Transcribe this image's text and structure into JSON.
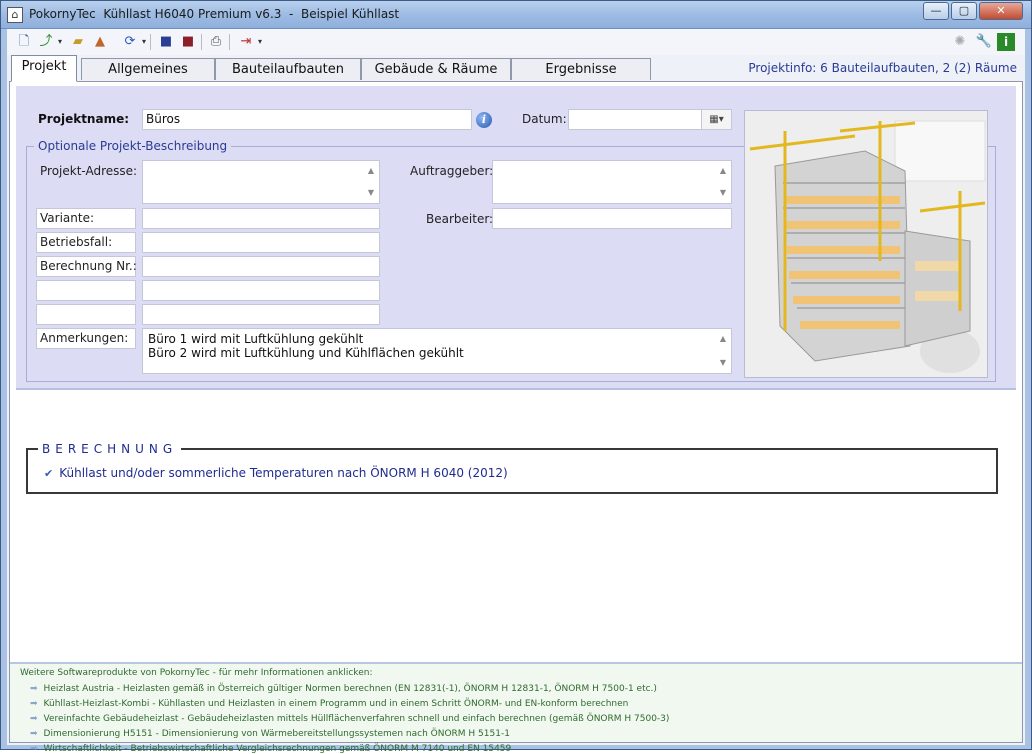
{
  "window": {
    "title": "PokornyTec  Kühllast H6040 Premium v6.3  -  Beispiel Kühllast",
    "minimize": "—",
    "maximize": "▢",
    "close": "✕"
  },
  "toolbar": {
    "icons": [
      "new-file-icon",
      "save-as-icon",
      "open-folder-icon",
      "import-icon",
      "refresh-icon",
      "save-icon",
      "save-all-icon",
      "print-icon",
      "exit-icon",
      "cycle-icon",
      "wrench-icon",
      "info-icon"
    ]
  },
  "tabs": [
    {
      "label": "Projekt",
      "active": true
    },
    {
      "label": "Allgemeines"
    },
    {
      "label": "Bauteilaufbauten"
    },
    {
      "label": "Gebäude & Räume"
    },
    {
      "label": "Ergebnisse"
    }
  ],
  "projektinfo": "Projektinfo: 6 Bauteilaufbauten,  2 (2) Räume",
  "form": {
    "projektname_label": "Projektname:",
    "projektname_value": "Büros",
    "datum_label": "Datum:",
    "datum_value": "",
    "group_title": "Optionale Projekt-Beschreibung",
    "adresse_label": "Projekt-Adresse:",
    "adresse_value": "",
    "auftraggeber_label": "Auftraggeber:",
    "auftraggeber_value": "",
    "bearbeiter_label": "Bearbeiter:",
    "bearbeiter_value": "",
    "rows": [
      {
        "label": "Variante:",
        "value": ""
      },
      {
        "label": "Betriebsfall:",
        "value": ""
      },
      {
        "label": "Berechnung Nr.:",
        "value": ""
      },
      {
        "label": "",
        "value": ""
      },
      {
        "label": "",
        "value": ""
      }
    ],
    "anmerkungen_label": "Anmerkungen:",
    "anmerkungen_line1": "Büro 1 wird mit Luftkühlung gekühlt",
    "anmerkungen_line2": "Büro 2 wird mit Luftkühlung und Kühlflächen gekühlt"
  },
  "berechnung": {
    "title": "BERECHNUNG",
    "item": "Kühllast und/oder sommerliche Temperaturen nach ÖNORM H 6040 (2012)"
  },
  "footer": {
    "header": "Weitere Softwareprodukte von PokornyTec  -  für mehr Informationen anklicken:",
    "items": [
      "Heizlast Austria  -  Heizlasten gemäß in Österreich gültiger Normen berechnen (EN 12831(-1), ÖNORM H 12831-1, ÖNORM H 7500-1 etc.)",
      "Kühllast-Heizlast-Kombi  -  Kühllasten und Heizlasten in einem Programm und in einem Schritt ÖNORM- und EN-konform berechnen",
      "Vereinfachte Gebäudeheizlast - Gebäudeheizlasten mittels Hüllflächenverfahren schnell und einfach berechnen (gemäß ÖNORM H 7500-3)",
      "Dimensionierung H5151  -  Dimensionierung von Wärmebereitstellungssystemen nach ÖNORM H 5151-1",
      "Wirtschaftlichkeit  -  Betriebswirtschaftliche Vergleichsrechnungen gemäß ÖNORM M 7140 und EN 15459"
    ]
  }
}
